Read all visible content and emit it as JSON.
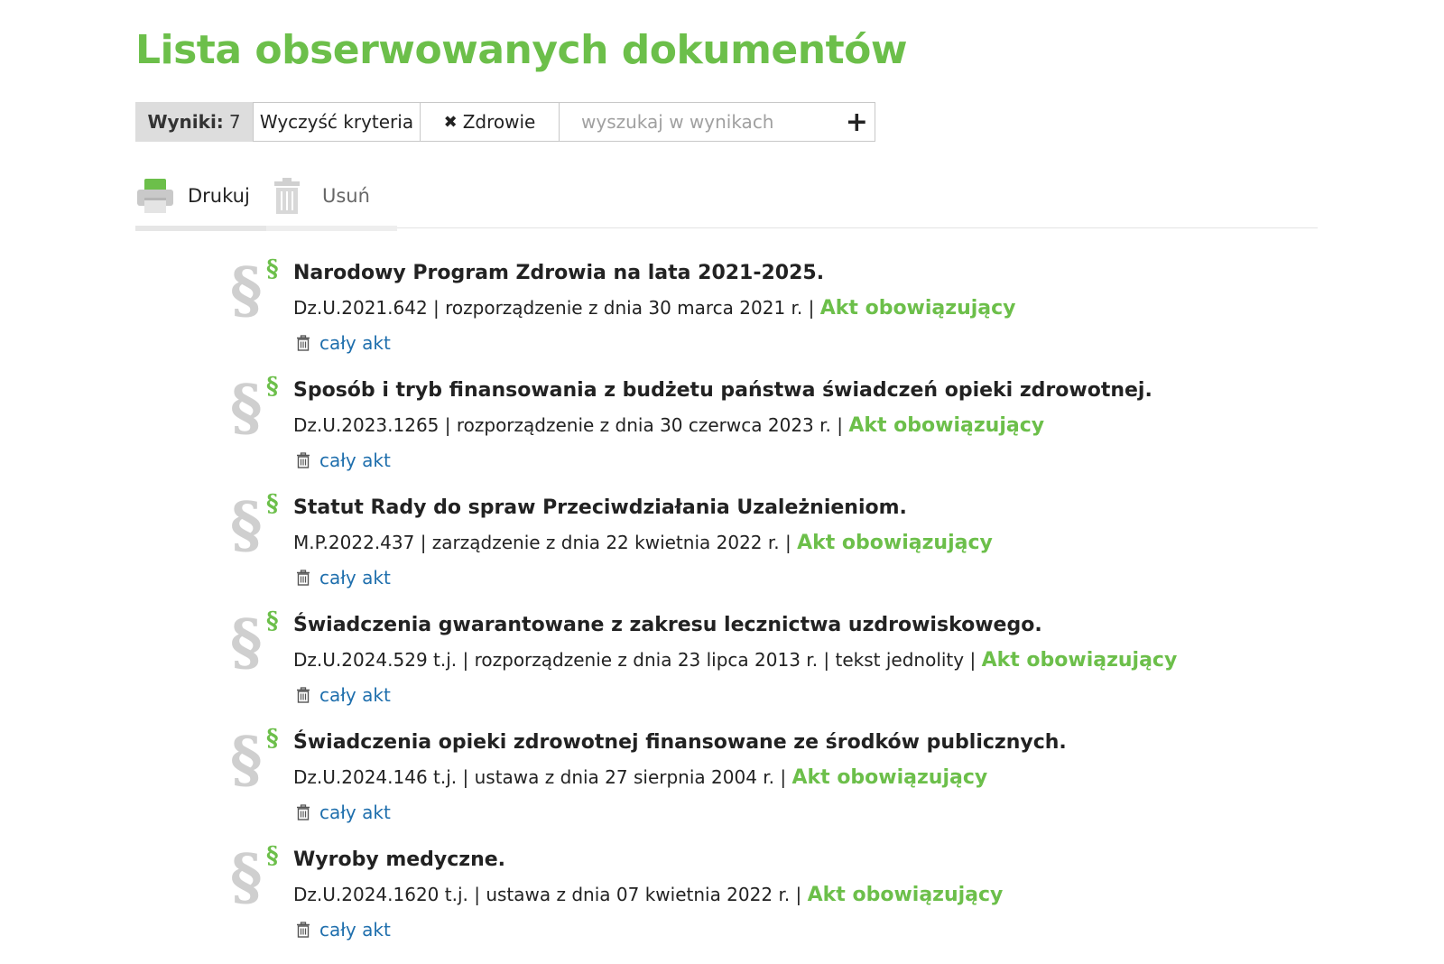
{
  "page": {
    "title": "Lista obserwowanych dokumentów"
  },
  "filter_bar": {
    "results_label": "Wyniki:",
    "results_count": "7",
    "clear_label": "Wyczyść kryteria",
    "chip_remove_glyph": "✖",
    "chip_label": "Zdrowie",
    "search_placeholder": "wyszukaj w wynikach",
    "add_glyph": "+"
  },
  "toolbar": {
    "print_label": "Drukuj",
    "print_icon": "printer-icon",
    "delete_label": "Usuń",
    "delete_icon": "trash-icon"
  },
  "documents": [
    {
      "title": "Narodowy Program Zdrowia na lata 2021-2025.",
      "meta": "Dz.U.2021.642 | rozporządzenie z dnia 30 marca 2021 r. |",
      "status": "Akt obowiązujący",
      "link": "cały akt"
    },
    {
      "title": "Sposób i tryb finansowania z budżetu państwa świadczeń opieki zdrowotnej.",
      "meta": "Dz.U.2023.1265 | rozporządzenie z dnia 30 czerwca 2023 r. |",
      "status": "Akt obowiązujący",
      "link": "cały akt"
    },
    {
      "title": "Statut Rady do spraw Przeciwdziałania Uzależnieniom.",
      "meta": "M.P.2022.437 | zarządzenie z dnia 22 kwietnia 2022 r. |",
      "status": "Akt obowiązujący",
      "link": "cały akt"
    },
    {
      "title": "Świadczenia gwarantowane z zakresu lecznictwa uzdrowiskowego.",
      "meta": "Dz.U.2024.529 t.j. | rozporządzenie z dnia 23 lipca 2013 r. | tekst jednolity |",
      "status": "Akt obowiązujący",
      "link": "cały akt"
    },
    {
      "title": "Świadczenia opieki zdrowotnej finansowane ze środków publicznych.",
      "meta": "Dz.U.2024.146 t.j. | ustawa z dnia 27 sierpnia 2004 r. |",
      "status": "Akt obowiązujący",
      "link": "cały akt"
    },
    {
      "title": "Wyroby medyczne.",
      "meta": "Dz.U.2024.1620 t.j. | ustawa z dnia 07 kwietnia 2022 r. |",
      "status": "Akt obowiązujący",
      "link": "cały akt"
    }
  ],
  "colors": {
    "accent_green": "#6cbf4a",
    "link_blue": "#1f6fad",
    "paragraph_gray": "#cfcfcf"
  },
  "icons": {
    "paragraph_big": "§",
    "paragraph_small": "§",
    "item_link_icon": "trash-icon"
  }
}
